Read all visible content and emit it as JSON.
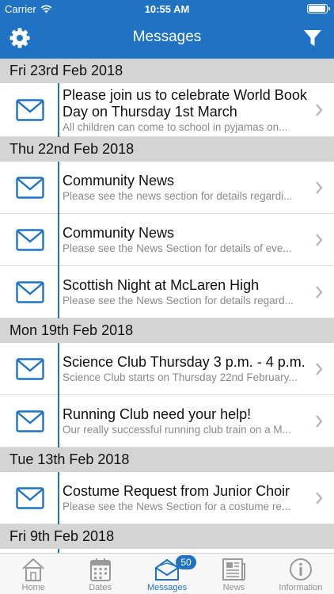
{
  "status_bar": {
    "carrier": "Carrier",
    "time": "10:55 AM"
  },
  "header": {
    "title": "Messages",
    "settings_icon": "gear-icon",
    "filter_icon": "filter-icon"
  },
  "sections": [
    {
      "date": "Fri 23rd Feb 2018",
      "messages": [
        {
          "title": "Please join us to celebrate World Book Day on Thursday 1st March",
          "preview": "All children can come to school in pyjamas on..."
        }
      ]
    },
    {
      "date": "Thu 22nd Feb 2018",
      "messages": [
        {
          "title": "Community News",
          "preview": "Please see the news section for details regardi..."
        },
        {
          "title": "Community News",
          "preview": "Please see the News Section for details of eve..."
        },
        {
          "title": "Scottish Night at McLaren High",
          "preview": "Please see the News Section for details regard..."
        }
      ]
    },
    {
      "date": "Mon 19th Feb 2018",
      "messages": [
        {
          "title": "Science Club Thursday 3 p.m. - 4 p.m.",
          "preview": "Science Club starts on Thursday 22nd February..."
        },
        {
          "title": "Running Club need your help!",
          "preview": "Our really successful running club train on a M..."
        }
      ]
    },
    {
      "date": "Tue 13th Feb 2018",
      "messages": [
        {
          "title": "Costume Request from Junior Choir",
          "preview": "Please see the News Section for a costume re..."
        }
      ]
    },
    {
      "date": "Fri 9th Feb 2018",
      "messages": []
    }
  ],
  "tabs": [
    {
      "label": "Home",
      "icon": "home-icon"
    },
    {
      "label": "Dates",
      "icon": "calendar-icon"
    },
    {
      "label": "Messages",
      "icon": "envelope-icon",
      "badge": "50",
      "active": true
    },
    {
      "label": "News",
      "icon": "newspaper-icon"
    },
    {
      "label": "Information",
      "icon": "info-icon"
    }
  ],
  "colors": {
    "accent": "#1f73c2",
    "section_bg": "#d4d4d4",
    "preview_text": "#8a8a8a"
  }
}
